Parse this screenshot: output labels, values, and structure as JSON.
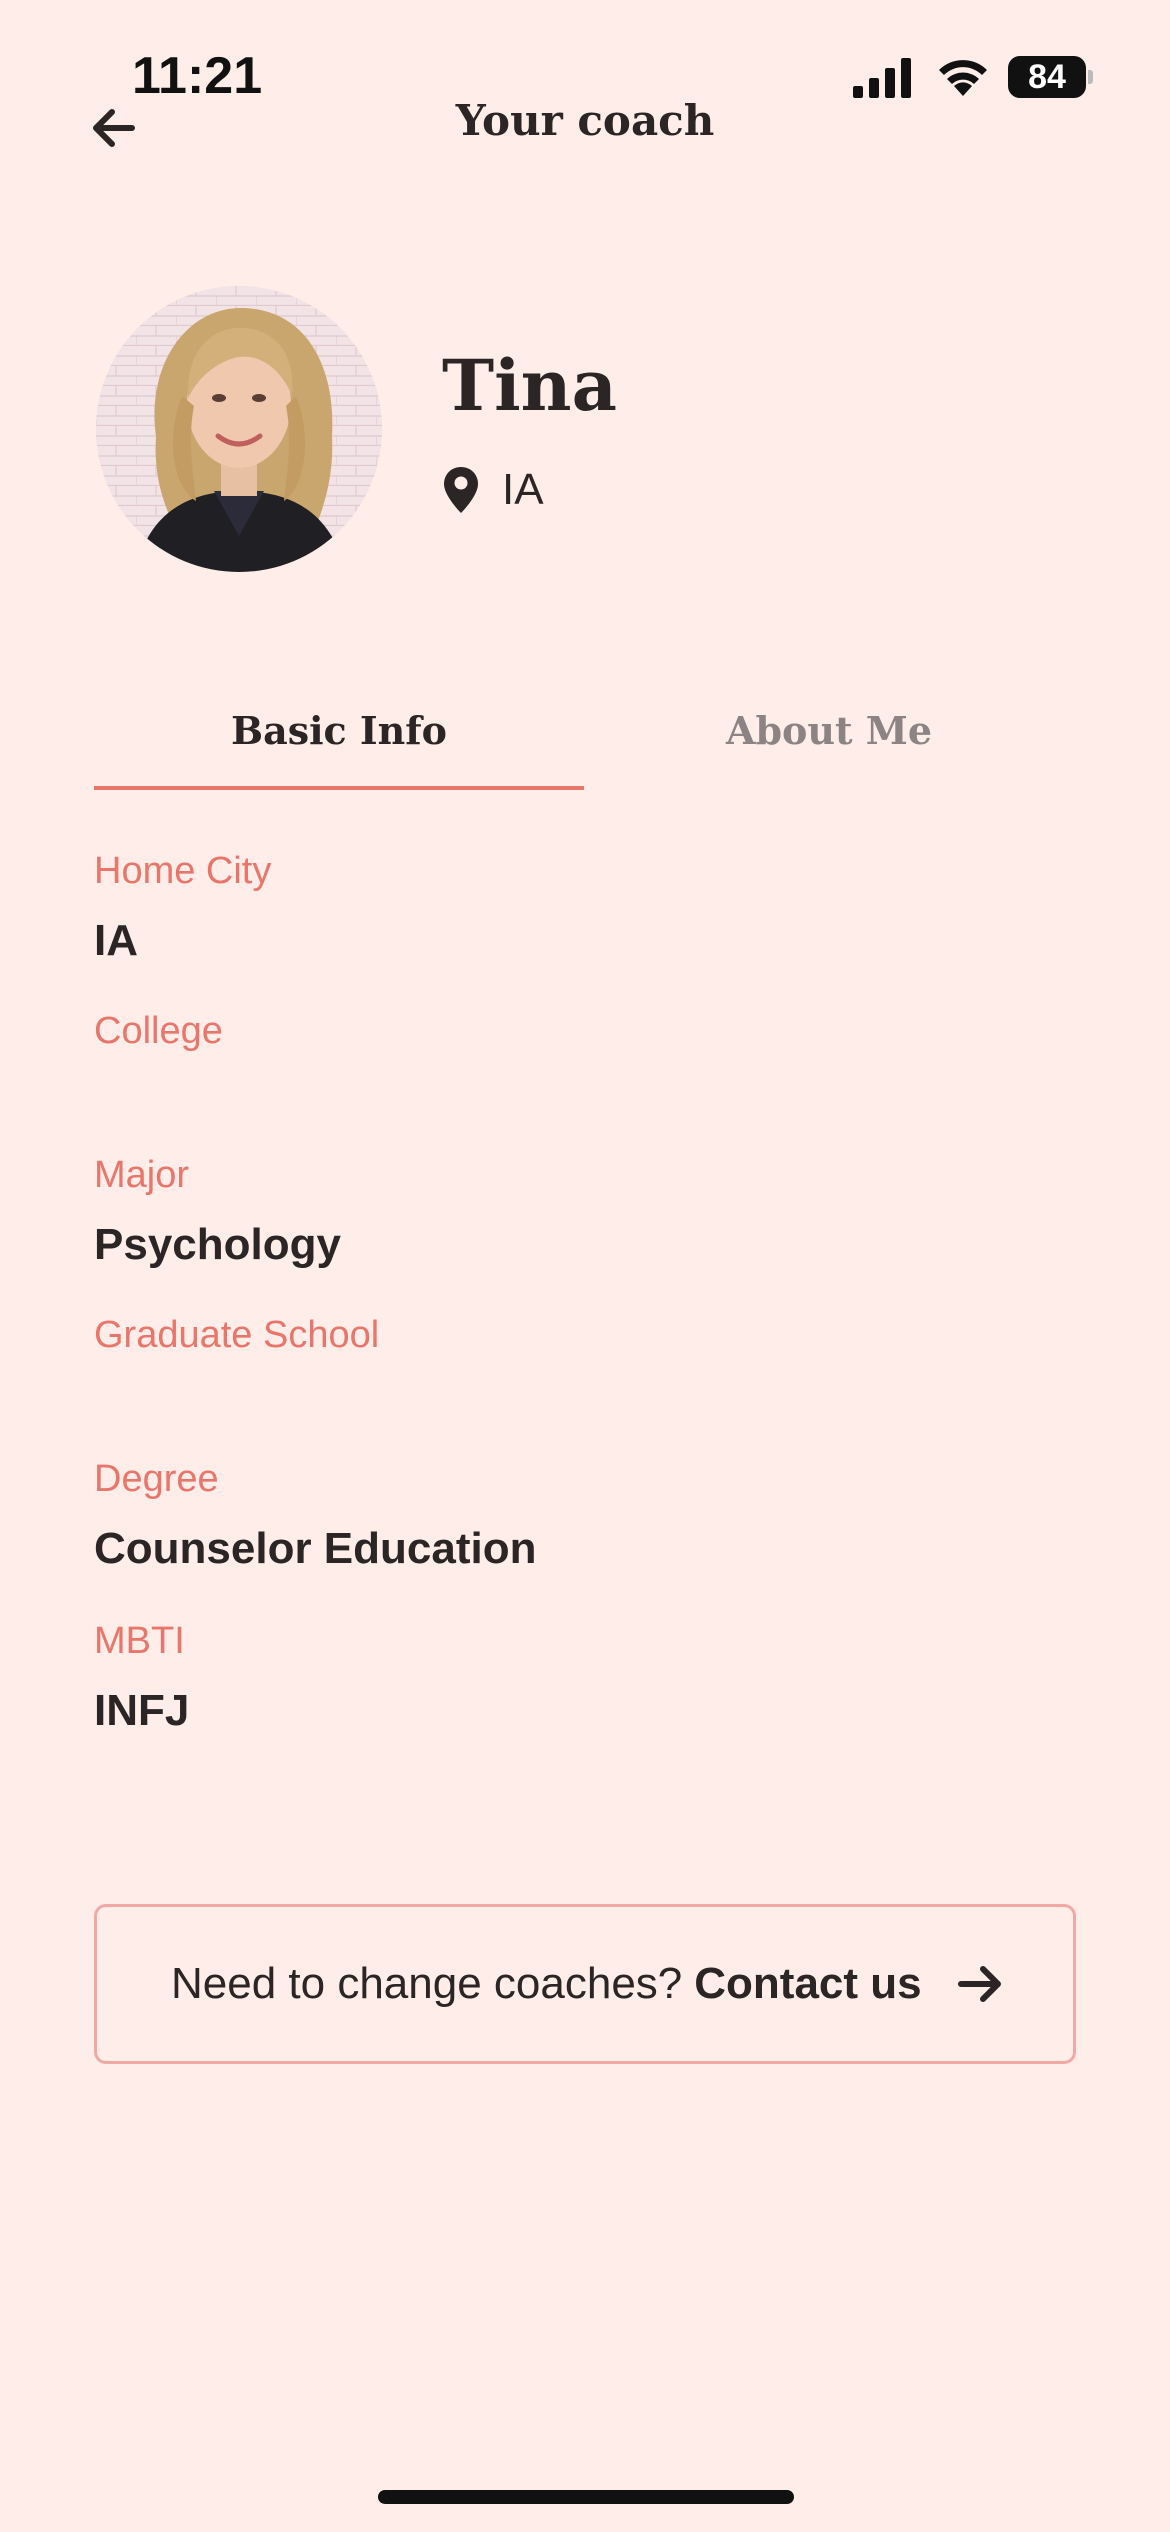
{
  "status_bar": {
    "time": "11:21",
    "battery": "84"
  },
  "header": {
    "title": "Your coach"
  },
  "profile": {
    "name": "Tina",
    "location": "IA"
  },
  "tabs": [
    {
      "label": "Basic Info",
      "active": true
    },
    {
      "label": "About Me",
      "active": false
    }
  ],
  "fields": [
    {
      "label": "Home City",
      "value": "IA"
    },
    {
      "label": "College",
      "value": ""
    },
    {
      "label": "Major",
      "value": "Psychology"
    },
    {
      "label": "Graduate School",
      "value": ""
    },
    {
      "label": "Degree",
      "value": "Counselor Education"
    },
    {
      "label": "MBTI",
      "value": "INFJ"
    }
  ],
  "contact": {
    "prompt": "Need to change coaches?",
    "link": "Contact us"
  },
  "colors": {
    "background": "#FEEDE8",
    "accent": "#E8766B",
    "text": "#2B2526"
  },
  "icons": [
    "back-arrow-icon",
    "location-pin-icon",
    "arrow-right-icon",
    "signal-icon",
    "wifi-icon",
    "battery-icon"
  ]
}
